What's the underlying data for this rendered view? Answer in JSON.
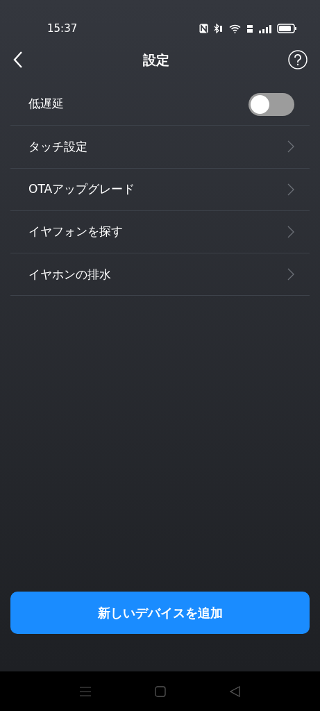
{
  "status_bar": {
    "time": "15:37"
  },
  "header": {
    "title": "設定"
  },
  "settings": [
    {
      "kind": "toggle",
      "label": "低遅延",
      "on": false
    },
    {
      "kind": "link",
      "label": "タッチ設定"
    },
    {
      "kind": "link",
      "label": "OTAアップグレード"
    },
    {
      "kind": "link",
      "label": "イヤフォンを探す"
    },
    {
      "kind": "link",
      "label": "イヤホンの排水"
    }
  ],
  "add_button": {
    "label": "新しいデバイスを追加"
  }
}
